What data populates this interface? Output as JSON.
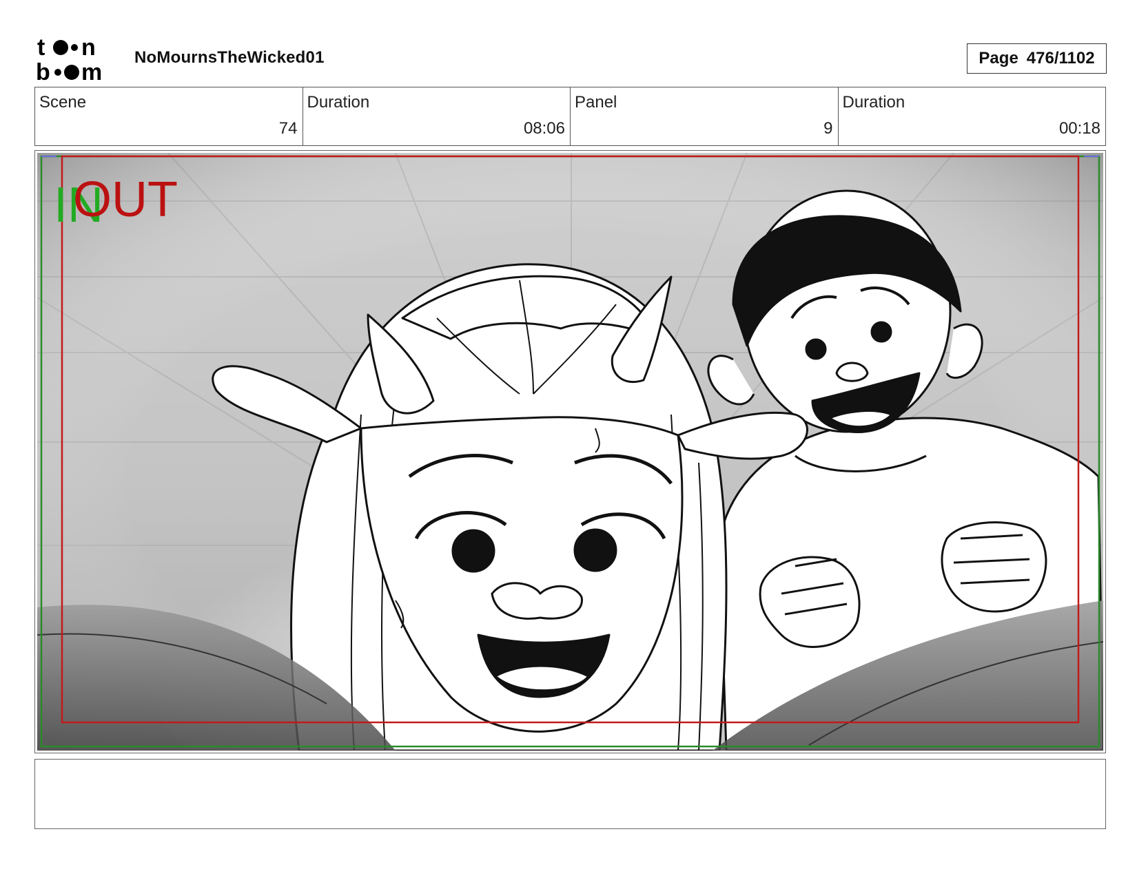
{
  "header": {
    "logo_text": "toon boom",
    "project_title": "NoMournsTheWicked01",
    "page_label": "Page",
    "page_value": "476/1102"
  },
  "info": {
    "scene_label": "Scene",
    "scene_value": "74",
    "scene_duration_label": "Duration",
    "scene_duration_value": "08:06",
    "panel_label": "Panel",
    "panel_value": "9",
    "panel_duration_label": "Duration",
    "panel_duration_value": "00:18"
  },
  "panel": {
    "in_marker": "IN",
    "out_marker": "OUT",
    "in_color": "#22aa22",
    "out_color": "#bb1111"
  },
  "notes": {
    "text": ""
  }
}
